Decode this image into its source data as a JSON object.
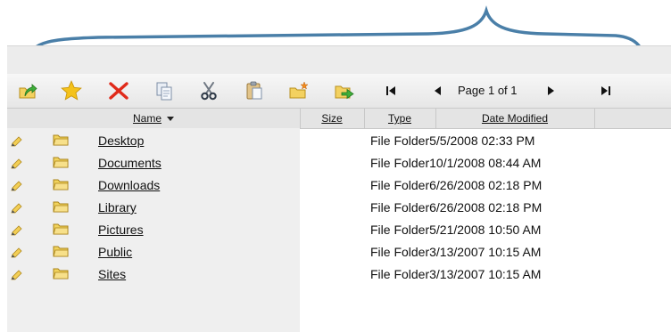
{
  "toolbar": {
    "buttons": [
      {
        "id": "up",
        "icon": "folder-up-icon"
      },
      {
        "id": "favorite",
        "icon": "star-icon"
      },
      {
        "id": "delete",
        "icon": "delete-x-icon"
      },
      {
        "id": "copy",
        "icon": "copy-icon"
      },
      {
        "id": "cut",
        "icon": "scissors-icon"
      },
      {
        "id": "paste",
        "icon": "paste-icon"
      },
      {
        "id": "new-folder",
        "icon": "new-folder-icon"
      },
      {
        "id": "move",
        "icon": "move-icon"
      }
    ],
    "pager": {
      "label": "Page 1 of 1"
    }
  },
  "columns": {
    "name": "Name",
    "size": "Size",
    "type": "Type",
    "modified": "Date Modified"
  },
  "files": [
    {
      "name": "Desktop",
      "meta": "File Folder5/5/2008 02:33 PM"
    },
    {
      "name": "Documents",
      "meta": "File Folder10/1/2008 08:44 AM"
    },
    {
      "name": "Downloads",
      "meta": "File Folder6/26/2008 02:18 PM"
    },
    {
      "name": "Library",
      "meta": "File Folder6/26/2008 02:18 PM"
    },
    {
      "name": "Pictures",
      "meta": "File Folder5/21/2008 10:50 AM"
    },
    {
      "name": "Public",
      "meta": "File Folder3/13/2007 10:15 AM"
    },
    {
      "name": "Sites",
      "meta": "File Folder3/13/2007 10:15 AM"
    }
  ],
  "colors": {
    "accent_brace": "#4a7fa8",
    "delete_red": "#e02a1a",
    "star_yellow": "#f4c21b",
    "folder_yellow": "#f1d35d"
  }
}
